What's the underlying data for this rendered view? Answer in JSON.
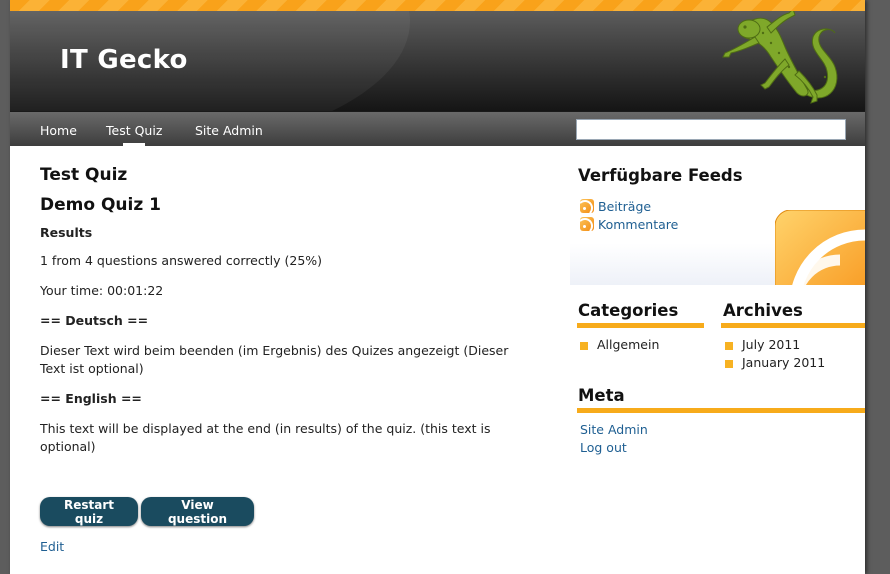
{
  "header": {
    "site_title": "IT Gecko"
  },
  "nav": {
    "items": [
      {
        "label": "Home"
      },
      {
        "label": "Test Quiz"
      },
      {
        "label": "Site Admin"
      }
    ],
    "active": "Test Quiz",
    "search": {
      "value": ""
    }
  },
  "main": {
    "page_title": "Test Quiz",
    "quiz_title": "Demo Quiz 1",
    "results_heading": "Results",
    "score_text": "1 from 4 questions answered correctly (25%)",
    "time_text": "Your time: 00:01:22",
    "deutsch_heading": "== Deutsch ==",
    "deutsch_text": "Dieser Text wird beim beenden (im Ergebnis) des Quizes angezeigt (Dieser Text ist optional)",
    "english_heading": "== English ==",
    "english_text": "This text will be displayed at the end (in results) of the quiz. (this text is optional)",
    "restart_label": "Restart quiz",
    "view_question_label": "View question",
    "edit_label": "Edit"
  },
  "sidebar": {
    "feeds_heading": "Verfügbare Feeds",
    "feeds": [
      {
        "label": "Beiträge",
        "icon": "rss-icon"
      },
      {
        "label": "Kommentare",
        "icon": "rss-icon"
      }
    ],
    "categories_heading": "Categories",
    "categories": [
      "Allgemein"
    ],
    "archives_heading": "Archives",
    "archives": [
      "July 2011",
      "January 2011"
    ],
    "meta_heading": "Meta",
    "meta_links": [
      "Site Admin",
      "Log out"
    ]
  },
  "colors": {
    "accent_orange": "#f7ab1b",
    "button_bg": "#1a4b5f",
    "link": "#1f5f92",
    "header_dark": "#262626"
  }
}
